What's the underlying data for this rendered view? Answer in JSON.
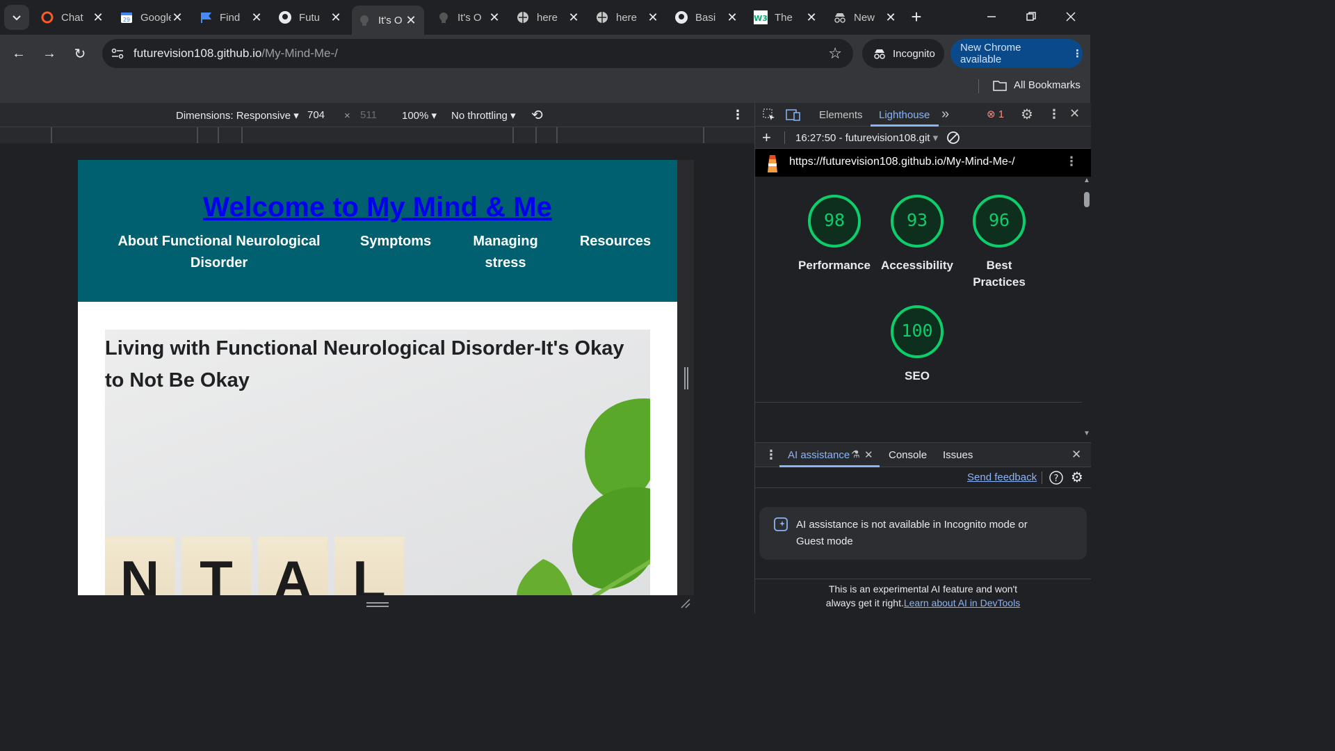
{
  "tabs": [
    {
      "title": "Chat",
      "icon": "red-ring-icon"
    },
    {
      "title": "Google",
      "icon": "calendar-icon"
    },
    {
      "title": "Find",
      "icon": "flag-icon"
    },
    {
      "title": "Futu",
      "icon": "github-icon"
    },
    {
      "title": "It's O",
      "icon": "head-icon",
      "active": true
    },
    {
      "title": "It's O",
      "icon": "head-icon"
    },
    {
      "title": "here",
      "icon": "globe-icon"
    },
    {
      "title": "here",
      "icon": "globe-icon"
    },
    {
      "title": "Basi",
      "icon": "github-icon"
    },
    {
      "title": "The",
      "icon": "w3-icon"
    },
    {
      "title": "New",
      "icon": "incognito-icon"
    }
  ],
  "toolbar": {
    "url_host": "futurevision108.github.io",
    "url_path": "/My-Mind-Me-/",
    "incognito_label": "Incognito",
    "new_chrome_label": "New Chrome available"
  },
  "bookmarks": {
    "all_bookmarks_label": "All Bookmarks"
  },
  "device_toolbar": {
    "dimensions_label": "Dimensions: Responsive",
    "width": "704",
    "times": "×",
    "height": "511",
    "zoom": "100%",
    "throttling": "No throttling"
  },
  "page": {
    "site_title": "Welcome to My Mind & Me",
    "nav": [
      "About Functional Neurological Disorder",
      "Symptoms",
      "Managing stress",
      "Resources"
    ],
    "hero_heading": "Living with Functional Neurological Disorder-It's Okay to Not Be Okay",
    "tile_letters": [
      "N",
      "T",
      "A",
      "L"
    ]
  },
  "devtools": {
    "tabs": [
      "Elements",
      "Lighthouse"
    ],
    "error_count": "1",
    "report_time": "16:27:50 - futurevision108.git",
    "report_url": "https://futurevision108.github.io/My-Mind-Me-/",
    "scores": [
      {
        "label": "Performance",
        "value": 98
      },
      {
        "label": "Accessibility",
        "value": 93
      },
      {
        "label": "Best Practices",
        "value": 96
      },
      {
        "label": "SEO",
        "value": 100
      }
    ],
    "drawer_tabs": [
      "AI assistance",
      "Console",
      "Issues"
    ],
    "send_feedback": "Send feedback",
    "ai_notice": "AI assistance is not available in Incognito mode or Guest mode",
    "ai_footer_text": "This is an experimental AI feature and won't always get it right.",
    "ai_footer_link": "Learn about AI in DevTools"
  },
  "colors": {
    "site_header_bg": "#00606f",
    "score_green": "#0cce6b",
    "link_blue": "#0000ee"
  }
}
